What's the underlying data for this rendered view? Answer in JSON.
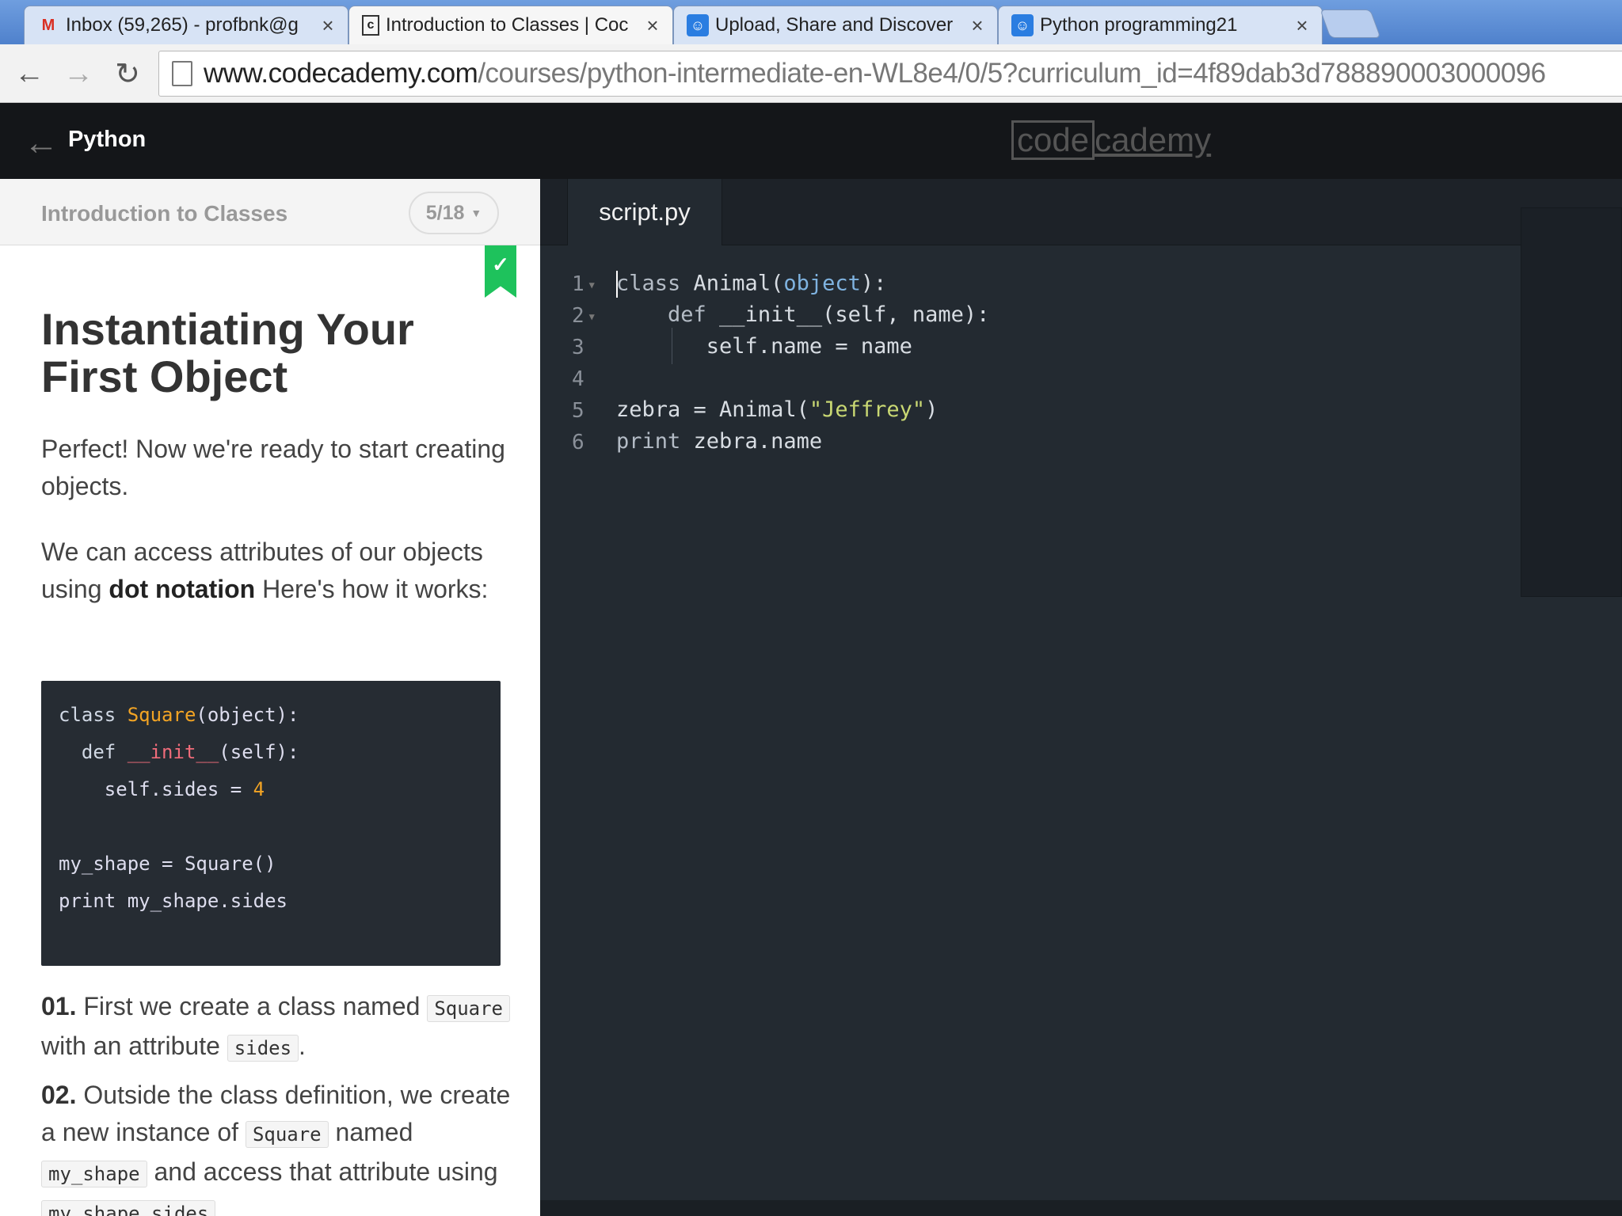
{
  "browser": {
    "tabs": [
      {
        "title": "Inbox (59,265) - profbnk@g",
        "icon": "gmail-icon"
      },
      {
        "title": "Introduction to Classes | Coc",
        "icon": "codecademy-icon"
      },
      {
        "title": "Upload, Share and Discover",
        "icon": "bot-icon"
      },
      {
        "title": "Python programming21",
        "icon": "bot-icon"
      }
    ],
    "url_host": "www.codecademy.com",
    "url_path": "/courses/python-intermediate-en-WL8e4/0/5?curriculum_id=4f89dab3d788890003000096"
  },
  "header": {
    "course": "Python",
    "logo_left": "code",
    "logo_right": "cademy"
  },
  "lesson": {
    "unit_title": "Introduction to Classes",
    "progress": "5/18",
    "heading": "Instantiating Your First Object",
    "intro": "Perfect! Now we're ready to start creating objects.",
    "p2_before": "We can access attributes of our objects using ",
    "p2_bold": "dot notation",
    "p2_after": " Here's how it works:",
    "sample_code": {
      "l1_kw": "class ",
      "l1_cls": "Square",
      "l1_rest": "(object):",
      "l2_kw": "  def ",
      "l2_fn": "__init__",
      "l2_rest": "(self):",
      "l3_a": "    self.sides = ",
      "l3_num": "4",
      "l5": "my_shape = Square()",
      "l6": "print my_shape.sides"
    },
    "step1_num": "01.",
    "step1_a": " First we create a class named ",
    "step1_code1": "Square",
    "step1_b": " with an attribute ",
    "step1_code2": "sides",
    "step1_c": ".",
    "step2_num": "02.",
    "step2_a": " Outside the class definition, we create a new instance of ",
    "step2_code1": "Square",
    "step2_b": " named ",
    "step2_code2": "my_shape",
    "step2_c": " and access that attribute using ",
    "step2_code3": "my_shape.sides",
    "step2_d": "."
  },
  "editor": {
    "filename": "script.py",
    "line_numbers": [
      "1",
      "2",
      "3",
      "4",
      "5",
      "6"
    ],
    "code": {
      "l1_kw": "class",
      "l1_name": " Animal(",
      "l1_obj": "object",
      "l1_end": "):",
      "l2_kw": "    def",
      "l2_rest": " __init__(self, name):",
      "l3": "       self.name = name",
      "l5_a": "zebra = Animal(",
      "l5_str": "\"Jeffrey\"",
      "l5_b": ")",
      "l6_kw": "print",
      "l6_rest": " zebra.name"
    }
  }
}
